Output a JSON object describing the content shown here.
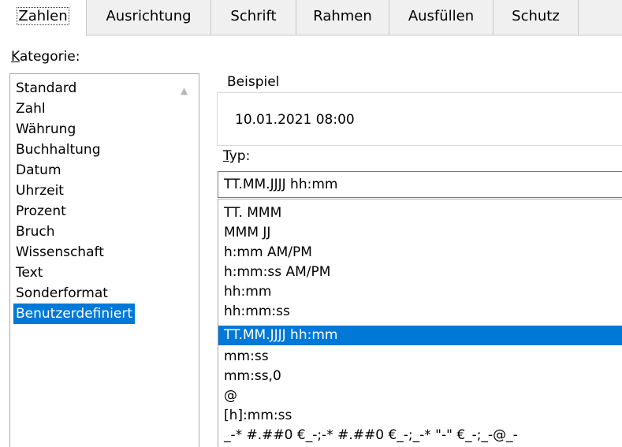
{
  "tabs": [
    "Zahlen",
    "Ausrichtung",
    "Schrift",
    "Rahmen",
    "Ausfüllen",
    "Schutz"
  ],
  "kategorie": {
    "label_access_key": "K",
    "label_rest": "ategorie:",
    "items": [
      "Standard",
      "Zahl",
      "Währung",
      "Buchhaltung",
      "Datum",
      "Uhrzeit",
      "Prozent",
      "Bruch",
      "Wissenschaft",
      "Text",
      "Sonderformat",
      "Benutzerdefiniert"
    ],
    "selected": "Benutzerdefiniert",
    "scroll_up_icon": "▲"
  },
  "beispiel": {
    "label": "Beispiel",
    "value": "10.01.2021 08:00"
  },
  "typ": {
    "label_access_key": "T",
    "label_rest": "yp:",
    "input_value": "TT.MM.JJJJ hh:mm",
    "items": [
      "TT. MMM",
      "MMM JJ",
      "h:mm AM/PM",
      "h:mm:ss AM/PM",
      "hh:mm",
      "hh:mm:ss",
      "TT.MM.JJJJ hh:mm",
      "mm:ss",
      "mm:ss,0",
      "@",
      "[h]:mm:ss",
      "_-* #.##0 €_-;-* #.##0 €_-;_-* \"-\" €_-;_-@_-"
    ],
    "selected": "TT.MM.JJJJ hh:mm"
  }
}
